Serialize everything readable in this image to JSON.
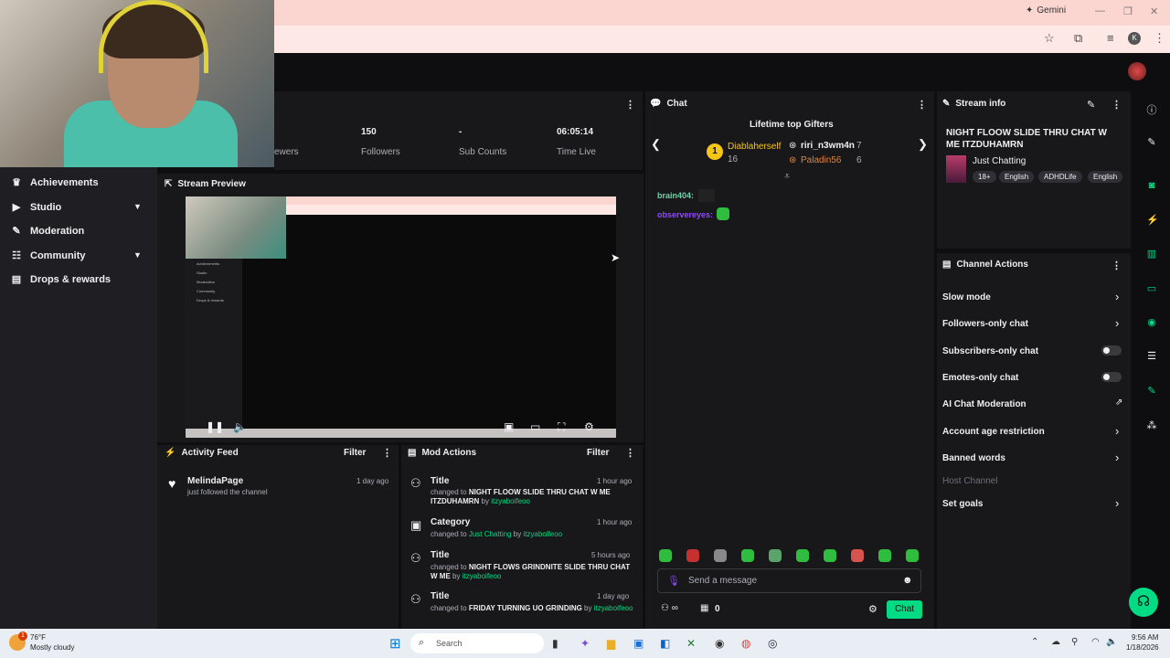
{
  "browser": {
    "gemini_label": "Gemini",
    "profile_initial": "K"
  },
  "stats": [
    {
      "value": "",
      "label": "ewers"
    },
    {
      "value": "150",
      "label": "Followers"
    },
    {
      "value": "-",
      "label": "Sub Counts"
    },
    {
      "value": "06:05:14",
      "label": "Time Live"
    }
  ],
  "nav": {
    "items": [
      {
        "label": "Achievements",
        "icon": "trophy-icon"
      },
      {
        "label": "Studio",
        "icon": "video-icon"
      },
      {
        "label": "Moderation",
        "icon": "wrench-icon"
      },
      {
        "label": "Community",
        "icon": "people-icon"
      },
      {
        "label": "Drops & rewards",
        "icon": "gift-icon"
      }
    ]
  },
  "preview": {
    "title": "Stream Preview",
    "inner_nav": [
      "Achievements",
      "Studio",
      "Moderation",
      "Community",
      "Drops & rewards"
    ]
  },
  "activity": {
    "title": "Activity Feed",
    "filter": "Filter",
    "items": [
      {
        "name": "MelindaPage",
        "text": "just followed the channel",
        "ago": "1 day ago"
      }
    ]
  },
  "mod_actions": {
    "title": "Mod Actions",
    "filter": "Filter",
    "items": [
      {
        "kind": "Title",
        "pre": "changed to ",
        "value": "NIGHT FLOOW SLIDE THRU CHAT W ME ITZDUHAMRN",
        "by": " by ",
        "user": "itzyaboifeoo",
        "ago": "1 hour ago"
      },
      {
        "kind": "Category",
        "pre": "changed to ",
        "value": "Just Chatting",
        "by": " by ",
        "user": "itzyaboifeoo",
        "ago": "1 hour ago"
      },
      {
        "kind": "Title",
        "pre": "changed to ",
        "value": "NIGHT FLOWS GRINDNITE SLIDE THRU CHAT W ME",
        "by": " by ",
        "user": "itzyaboifeoo",
        "ago": "5 hours ago"
      },
      {
        "kind": "Title",
        "pre": "changed to ",
        "value": "FRIDAY TURNING UO GRINDING",
        "by": " by ",
        "user": "itzyaboifeoo",
        "ago": "1 day ago"
      }
    ]
  },
  "chat": {
    "title": "Chat",
    "gifters_title": "Lifetime top Gifters",
    "rank_badge": "1",
    "gifters": [
      {
        "name": "Diablaherself",
        "count": "16"
      },
      {
        "name": "riri_n3wm4n",
        "count": "7"
      },
      {
        "name": "Paladin56",
        "count": "6"
      }
    ],
    "messages": [
      {
        "user": "brain404:"
      },
      {
        "user": "observereyes:"
      }
    ],
    "placeholder": "Send a message",
    "points": "0",
    "send_label": "Chat"
  },
  "stream_info": {
    "title": "Stream info",
    "stream_title": "NIGHT FLOOW SLIDE THRU CHAT W ME ITZDUHAMRN",
    "category": "Just Chatting",
    "tags": [
      "18+",
      "English",
      "ADHDLife",
      "English"
    ]
  },
  "channel_actions": {
    "title": "Channel Actions",
    "rows": [
      {
        "label": "Slow mode",
        "control": "arrow"
      },
      {
        "label": "Followers-only chat",
        "control": "arrow"
      },
      {
        "label": "Subscribers-only chat",
        "control": "toggle"
      },
      {
        "label": "Emotes-only chat",
        "control": "toggle"
      },
      {
        "label": "AI Chat Moderation",
        "control": "external"
      },
      {
        "label": "Account age restriction",
        "control": "arrow"
      },
      {
        "label": "Banned words",
        "control": "arrow"
      },
      {
        "label": "Host Channel",
        "control": "none"
      },
      {
        "label": "Set goals",
        "control": "arrow"
      }
    ]
  },
  "taskbar": {
    "temp": "76°F",
    "weather": "Mostly cloudy",
    "search": "Search",
    "time": "9:56 AM",
    "date": "1/18/2026",
    "notif_count": "1"
  },
  "colors": {
    "accent": "#00db84",
    "panel": "#18181b",
    "bg": "#0e0e10"
  }
}
